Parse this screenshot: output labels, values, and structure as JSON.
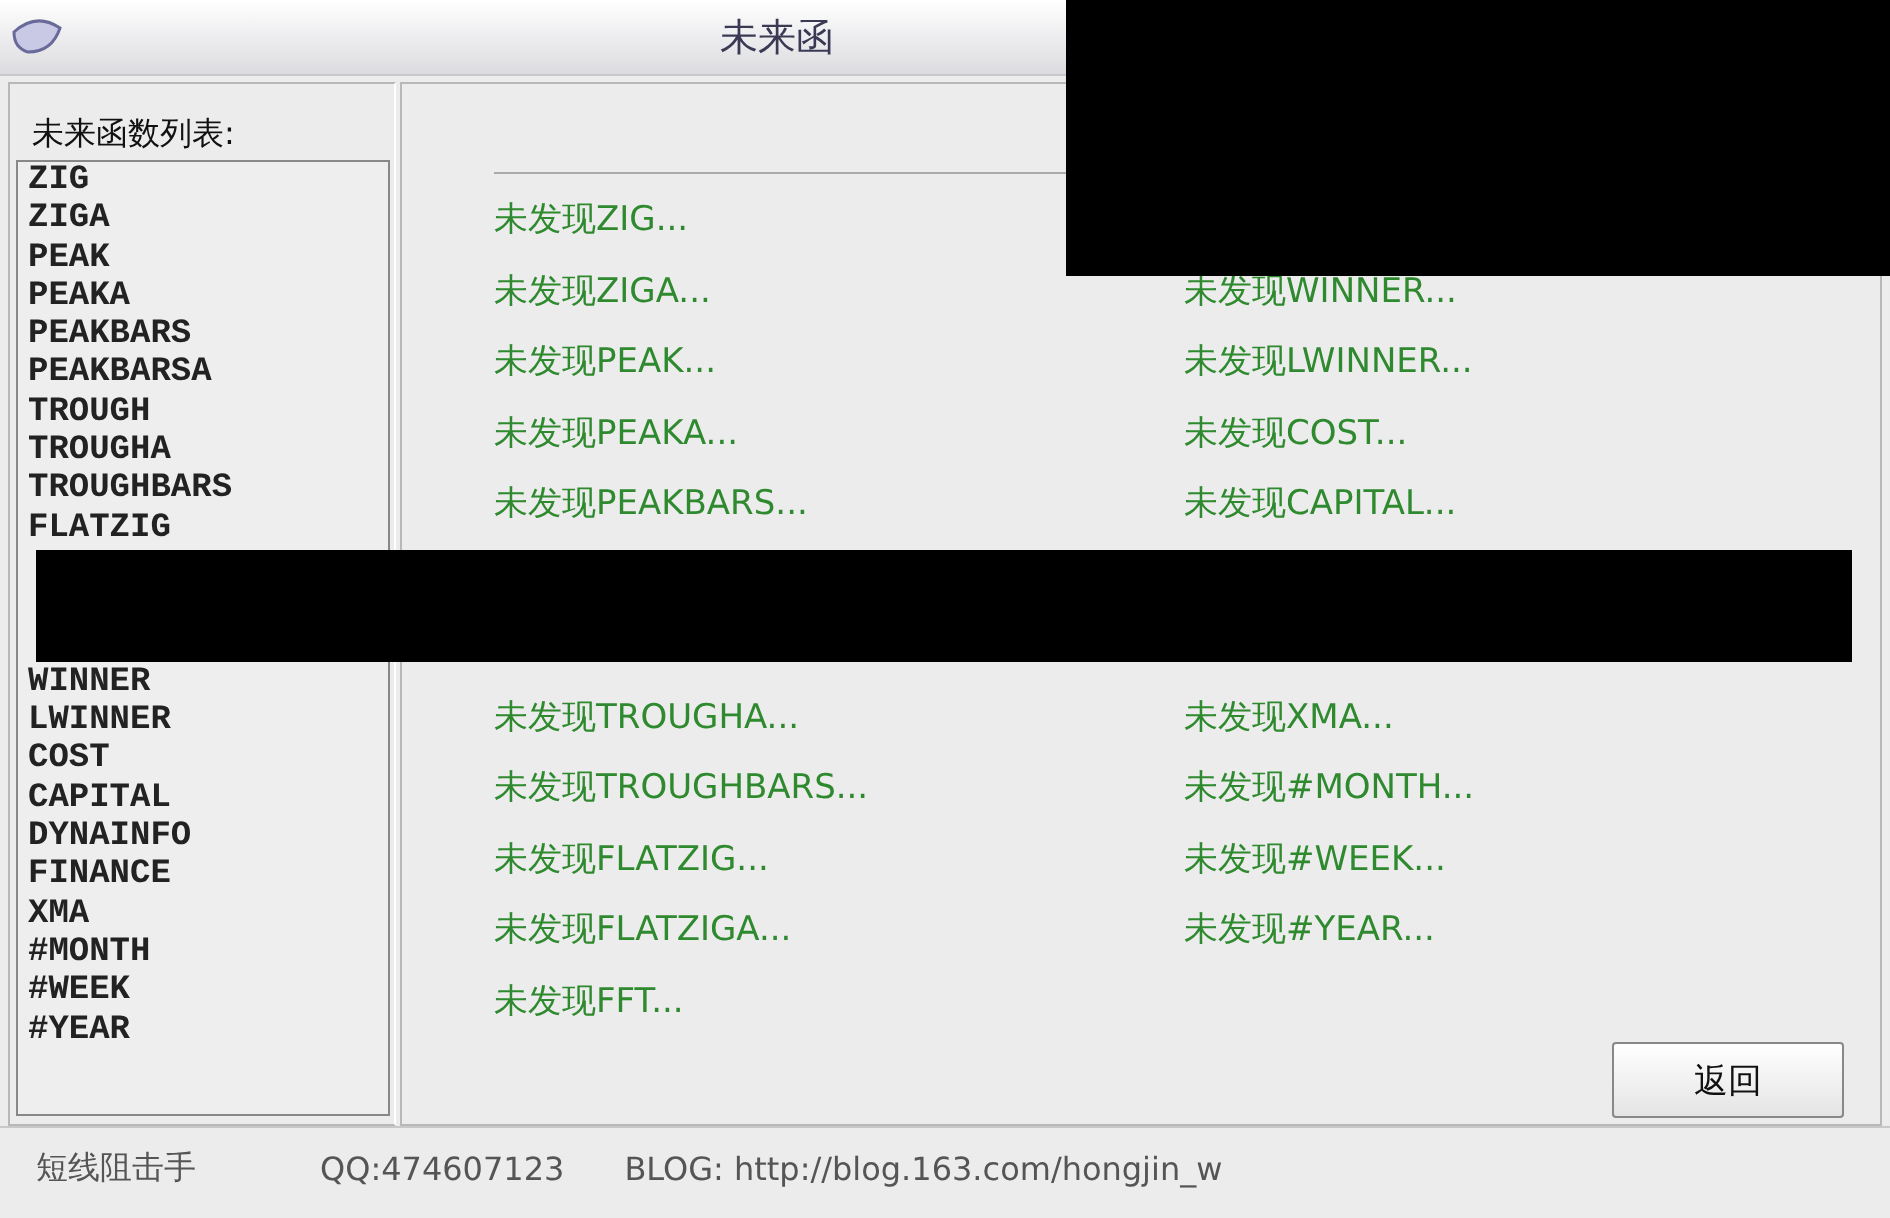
{
  "window": {
    "title": "未来函"
  },
  "function_list": {
    "label": "未来函数列表:",
    "items_upper": [
      "ZIG",
      "ZIGA",
      "PEAK",
      "PEAKA",
      "PEAKBARS",
      "PEAKBARSA",
      "TROUGH",
      "TROUGHA",
      "TROUGHBARS",
      "FLATZIG"
    ],
    "items_lower": [
      "WINNER",
      "LWINNER",
      "COST",
      "CAPITAL",
      "DYNAINFO",
      "FINANCE",
      "XMA",
      "#MONTH",
      "#WEEK",
      "#YEAR"
    ]
  },
  "results_upper": {
    "column_1": [
      "未发现ZIG...",
      "未发现ZIGA...",
      "未发现PEAK...",
      "未发现PEAKA...",
      "未发现PEAKBARS..."
    ],
    "column_2": [
      "未发现WINNER...",
      "未发现LWINNER...",
      "未发现COST...",
      "未发现CAPITAL..."
    ]
  },
  "results_lower": {
    "column_1": [
      "未发现TROUGHA...",
      "未发现TROUGHBARS...",
      "未发现FLATZIG...",
      "未发现FLATZIGA...",
      "未发现FFT..."
    ],
    "column_2": [
      "未发现XMA...",
      "未发现#MONTH...",
      "未发现#WEEK...",
      "未发现#YEAR..."
    ]
  },
  "buttons": [
    "返回"
  ],
  "status_bar": [
    "短线阻击手",
    "QQ:474607123",
    "BLOG: http://blog.163.com/hongjin_w"
  ]
}
